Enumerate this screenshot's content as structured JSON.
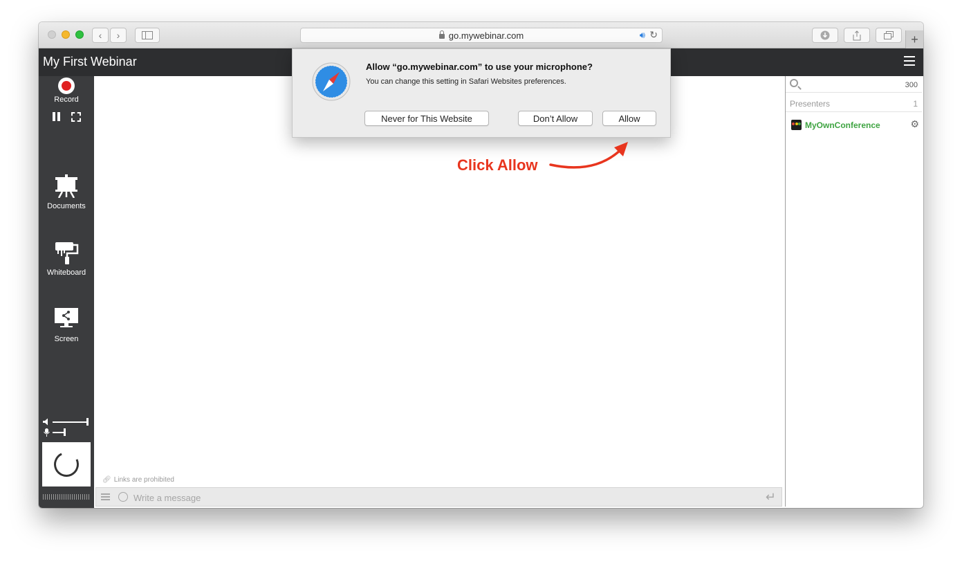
{
  "browser": {
    "url": "go.mywebinar.com"
  },
  "app": {
    "title": "My First Webinar"
  },
  "sidebar": {
    "record_label": "Record",
    "documents_label": "Documents",
    "whiteboard_label": "Whiteboard",
    "screen_label": "Screen",
    "speaker_volume": 0.95,
    "mic_volume": 0.3
  },
  "chat": {
    "links_note": "Links are prohibited",
    "placeholder": "Write a message"
  },
  "right_panel": {
    "count": "300",
    "presenters_label": "Presenters",
    "presenters_count": "1",
    "presenter_name": "MyOwnConference"
  },
  "dialog": {
    "title": "Allow “go.mywebinar.com” to use your microphone?",
    "subtitle": "You can change this setting in Safari Websites preferences.",
    "never_label": "Never for This Website",
    "dont_allow_label": "Don’t Allow",
    "allow_label": "Allow"
  },
  "annotation": {
    "text": "Click Allow",
    "color": "#e8351e"
  },
  "colors": {
    "header_bg": "#2d2e30",
    "sidebar_bg": "#3b3c3e",
    "presenter_green": "#3fa442",
    "record_red": "#e02020"
  }
}
